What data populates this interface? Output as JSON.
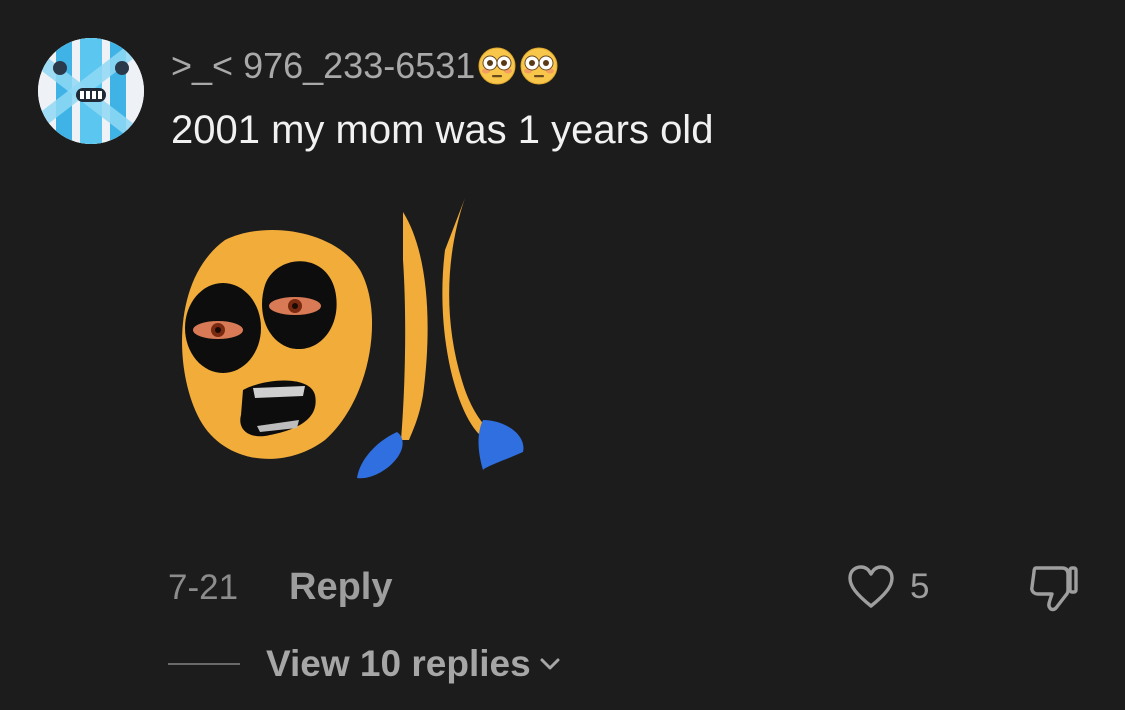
{
  "comment": {
    "username": ">_< 976_233-6531",
    "username_emojis": [
      "flushed-face-emoji",
      "flushed-face-emoji"
    ],
    "text": "2001 my mom was 1 years old",
    "timestamp": "7-21",
    "reply_label": "Reply",
    "like_count": "5",
    "view_replies_label": "View 10 replies"
  },
  "icons": {
    "avatar": "avatar",
    "like": "heart-outline-icon",
    "dislike": "thumbs-down-icon",
    "expand": "chevron-down-icon"
  },
  "colors": {
    "background": "#1c1c1c",
    "text_primary": "#f1f1f1",
    "text_secondary": "#a9a9a9",
    "sticker_yellow": "#f2ac3a",
    "sticker_blue": "#2f6fe0"
  }
}
